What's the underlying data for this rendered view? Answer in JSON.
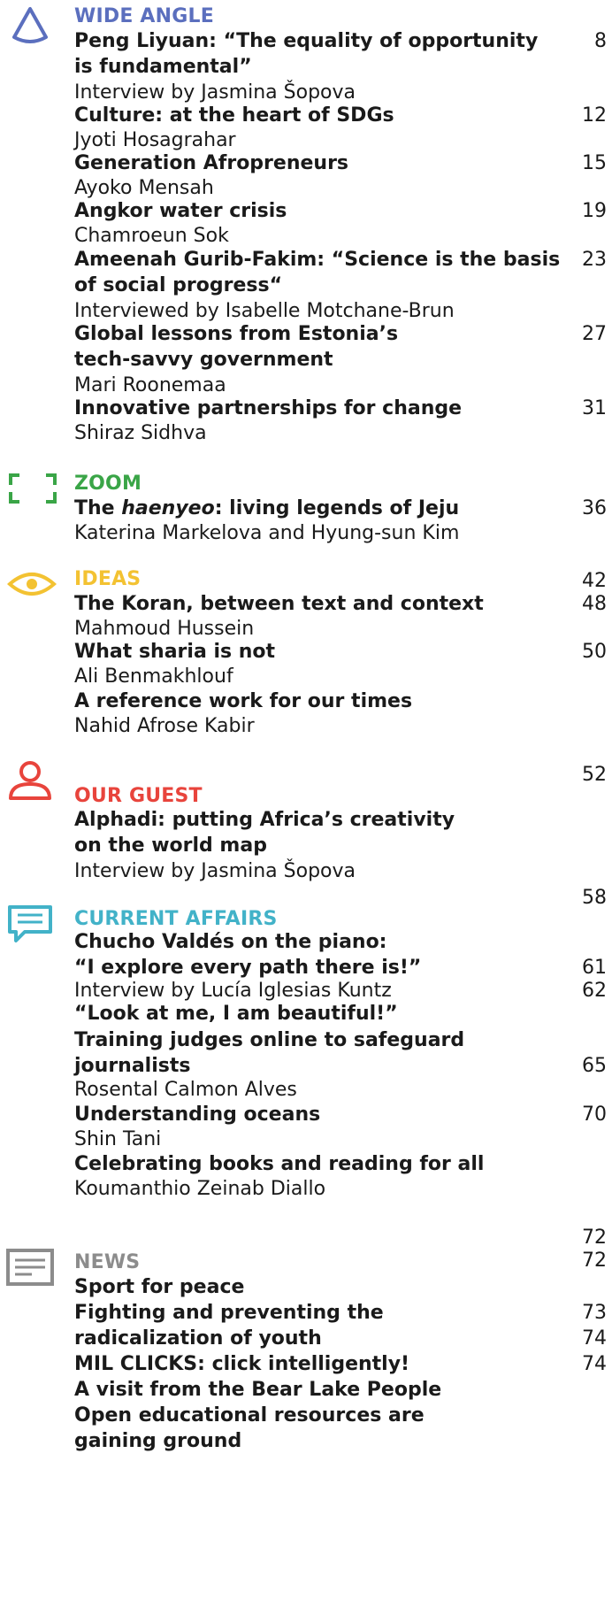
{
  "colors": {
    "wide_angle": "#5b6fbe",
    "zoom": "#3aa547",
    "ideas": "#f3c232",
    "our_guest": "#e8443c",
    "current_affairs": "#42b2c8",
    "news": "#8c8c8c"
  },
  "wide_angle": {
    "title": "WIDE ANGLE",
    "icon": "triangle-icon",
    "t1a": "Peng Liyuan: “The equality of opportunity",
    "t1b": "is fundamental”",
    "a1": "Interview by Jasmina Šopova",
    "p1": "8",
    "t2": "Culture: at the heart of SDGs",
    "a2": "Jyoti Hosagrahar",
    "p2": "12",
    "t3": "Generation Afropreneurs",
    "a3": "Ayoko Mensah",
    "p3": "15",
    "t4": "Angkor water crisis",
    "a4": "Chamroeun Sok",
    "p4": "19",
    "t5a": "Ameenah Gurib-Fakim: “Science is the basis",
    "t5b": "of social progress“",
    "a5": "Interviewed by Isabelle Motchane-Brun",
    "p5": "23",
    "t6a": "Global lessons from Estonia’s",
    "t6b": "tech-savvy government",
    "a6": "Mari Roonemaa",
    "p6": "27",
    "t7": "Innovative partnerships for change",
    "a7": "Shiraz Sidhva",
    "p7": "31"
  },
  "zoom": {
    "title": "ZOOM",
    "icon": "frame-corners-icon",
    "t1_pre": "The ",
    "t1_em": "haenyeo",
    "t1_post": ": living legends of Jeju",
    "a1": "Katerina Markelova and Hyung-sun Kim",
    "p1": "36"
  },
  "ideas": {
    "title": "IDEAS",
    "icon": "eye-icon",
    "p0": "42",
    "t1": "The Koran, between text and context",
    "a1": "Mahmoud Hussein",
    "p1": "48",
    "t2": "What sharia is not",
    "a2": "Ali Benmakhlouf",
    "p2": "50",
    "t3": "A reference work for our times",
    "a3": "Nahid Afrose Kabir",
    "p3": "52"
  },
  "our_guest": {
    "title": "OUR GUEST",
    "icon": "person-icon",
    "t1a": "Alphadi: putting Africa’s creativity",
    "t1b": "on the world map",
    "a1": "Interview by Jasmina Šopova",
    "p1": "58"
  },
  "current_affairs": {
    "title": "CURRENT AFFAIRS",
    "icon": "speech-bubble-icon",
    "t1a": "Chucho Valdés on the piano:",
    "t1b": "“I explore every path there is!”",
    "a1": "Interview by Lucía Iglesias Kuntz",
    "p1": "61",
    "t2": "“Look at me, I am beautiful!”",
    "p2": "62",
    "t3a": "Training judges online to safeguard",
    "t3b": "journalists",
    "a3": "Rosental Calmon Alves",
    "p3": "65",
    "t4": "Understanding oceans",
    "a4": "Shin Tani",
    "p4": "70",
    "t5": "Celebrating books and reading for all",
    "a5": "Koumanthio Zeinab Diallo",
    "p5": "72"
  },
  "news": {
    "title": "NEWS",
    "icon": "newspaper-icon",
    "p0": "72",
    "t1": "Sport for peace",
    "t2a": "Fighting and preventing the",
    "t2b": "radicalization of youth",
    "p2a": "73",
    "p2b": "74",
    "t3": "MIL CLICKS: click intelligently!",
    "p3": "74",
    "t4": "A visit from the Bear Lake People",
    "t5a": "Open educational resources are",
    "t5b": "gaining ground"
  }
}
